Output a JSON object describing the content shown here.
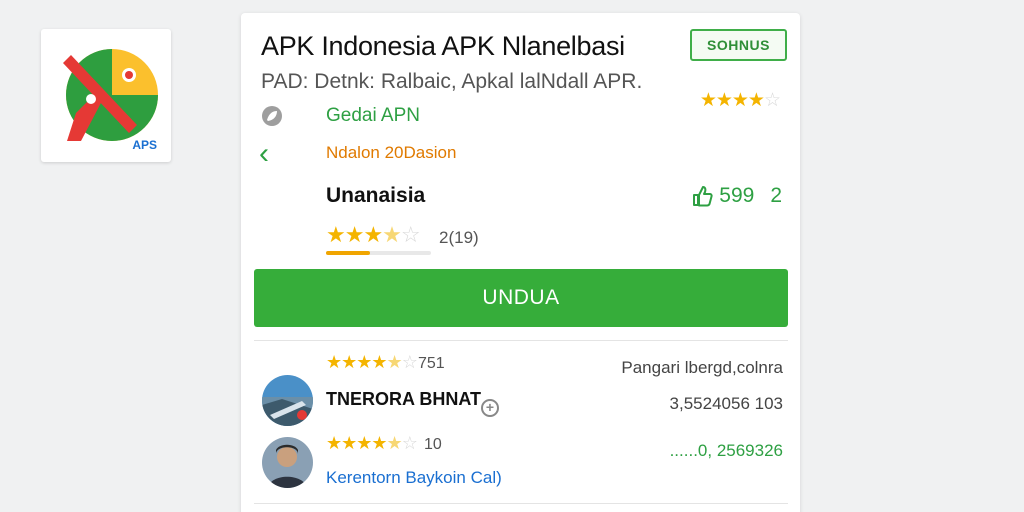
{
  "app_icon": {
    "caption": "APS",
    "colors": {
      "green": "#2e9e3f",
      "red": "#e53935",
      "yellow": "#fbc02d",
      "blue": "#1a6fd1"
    }
  },
  "header": {
    "title": "APK Indonesia APK Nlanelbasi",
    "badge": "SOHNUS",
    "subtitle": "PAD: Detnk: Ralbaic, Apkal lalNdall APR."
  },
  "meta": {
    "top_rating": "★★★★",
    "top_rating_dim": "☆",
    "category_label": "Gedai APN",
    "version_label": "Ndalon 20Dasion",
    "developer": "Unanaisia",
    "likes": "599",
    "likes_suffix": "2",
    "stars": "★★★",
    "stars_half": "★",
    "stars_dim": "☆",
    "rating_count": "2(19)",
    "rating_progress": 0.42
  },
  "download": {
    "label": "UNDUA"
  },
  "reviews": {
    "summary_stars": "★★★★",
    "summary_half": "★",
    "summary_dim": "☆",
    "summary_count": "751",
    "header_right": "Pangari lbergd,colnra",
    "items": [
      {
        "name": "TNERORA BHNAT",
        "amount": "3,5524056 103"
      },
      {
        "stars": "★★★★",
        "half": "★",
        "dim": "☆",
        "count": "10",
        "amount": "......0, 2569326",
        "link": "Kerentorn Baykoin Cal)"
      }
    ]
  },
  "colors": {
    "accent_green": "#36ad3a",
    "star_gold": "#f4b400",
    "link_blue": "#1a6fd1",
    "orange": "#e07a00"
  }
}
